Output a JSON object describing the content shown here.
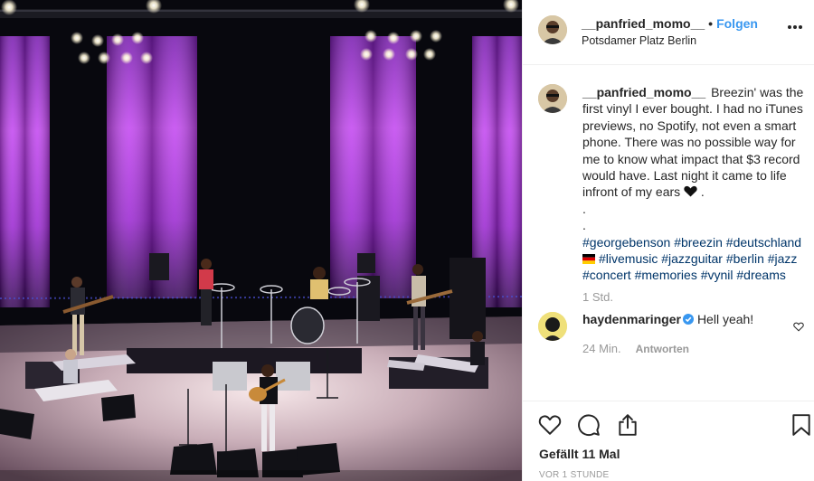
{
  "post": {
    "username": "__panfried_momo__",
    "follow_label": "Folgen",
    "location": "Potsdamer Platz Berlin",
    "caption": {
      "username": "__panfried_momo__",
      "text": "Breezin' was the first vinyl I ever bought. I had no iTunes previews, no Spotify, not even a smart phone. There was no possible way for me to know what impact that $3 record would have. Last night it came to life infront of my ears",
      "text_end": " .",
      "dot1": ".",
      "dot2": ".",
      "hashtags_line1": "#georgebenson #breezin #deutschland",
      "hashtags_line2": "#livemusic #jazzguitar #berlin #jazz #concert #memories #vynil #dreams",
      "time": "1 Std."
    },
    "reply": {
      "username": "haydenmaringer",
      "text": "Hell yeah!",
      "time": "24 Min.",
      "reply_label": "Antworten"
    },
    "likes": "Gefällt 11 Mal",
    "timestamp": "VOR 1 STUNDE"
  },
  "icons": {
    "more": "more-options-icon",
    "like": "heart-icon",
    "comment": "comment-icon",
    "share": "share-icon",
    "save": "bookmark-icon",
    "verified": "verified-badge-icon"
  },
  "colors": {
    "link_blue": "#3897f0",
    "hashtag": "#003569",
    "muted": "#999999",
    "stage_purple": "#b438e6"
  }
}
